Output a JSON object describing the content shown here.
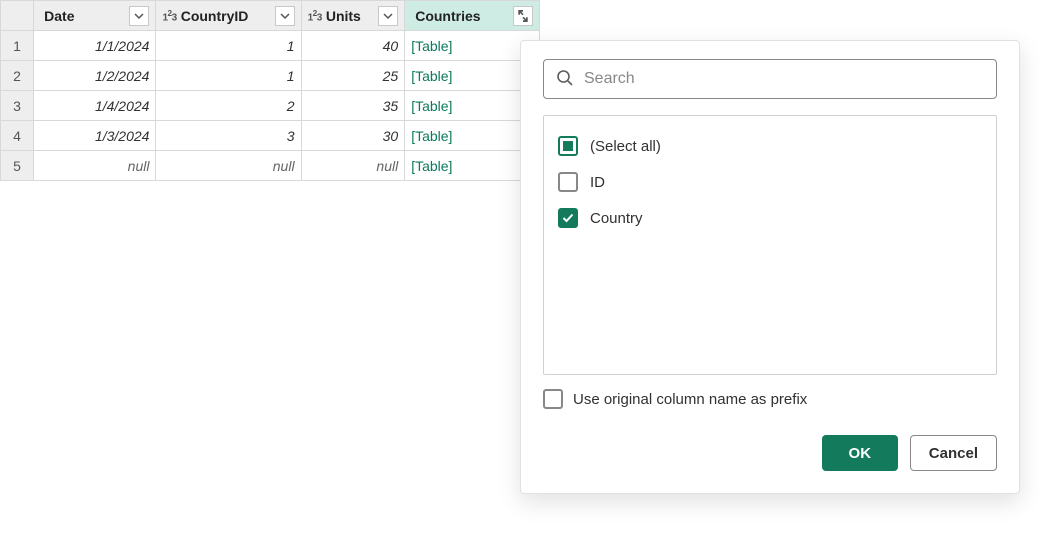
{
  "columns": {
    "date": "Date",
    "countryId": "CountryID",
    "units": "Units",
    "countries": "Countries"
  },
  "rows": [
    {
      "n": "1",
      "date": "1/1/2024",
      "cid": "1",
      "units": "40",
      "countries": "[Table]"
    },
    {
      "n": "2",
      "date": "1/2/2024",
      "cid": "1",
      "units": "25",
      "countries": "[Table]"
    },
    {
      "n": "3",
      "date": "1/4/2024",
      "cid": "2",
      "units": "35",
      "countries": "[Table]"
    },
    {
      "n": "4",
      "date": "1/3/2024",
      "cid": "3",
      "units": "30",
      "countries": "[Table]"
    },
    {
      "n": "5",
      "date": "null",
      "cid": "null",
      "units": "null",
      "countries": "[Table]"
    }
  ],
  "popup": {
    "searchPlaceholder": "Search",
    "options": {
      "selectAll": "(Select all)",
      "id": "ID",
      "country": "Country"
    },
    "prefixLabel": "Use original column name as prefix",
    "ok": "OK",
    "cancel": "Cancel"
  }
}
